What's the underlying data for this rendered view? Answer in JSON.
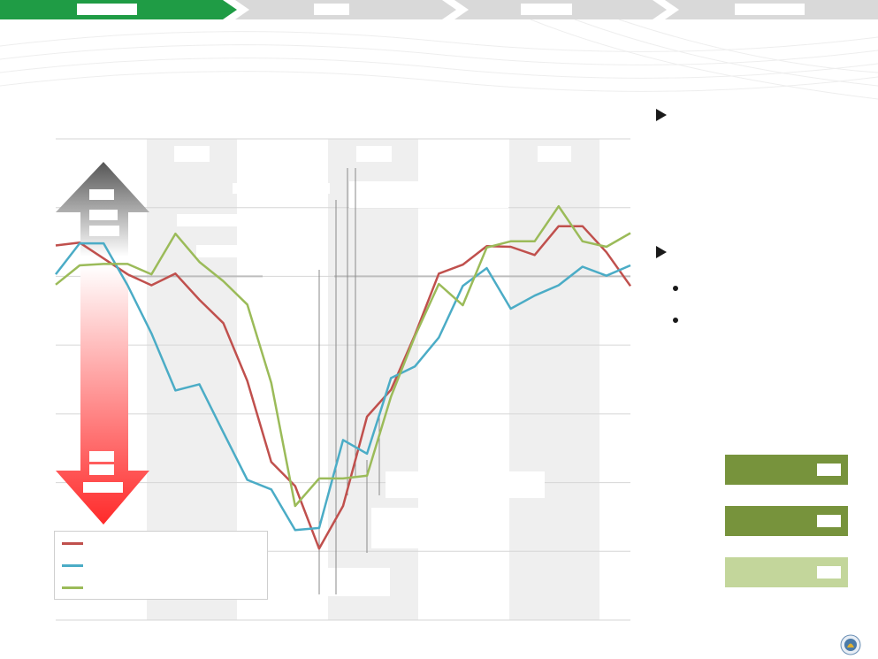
{
  "nav": {
    "steps": [
      {
        "label": "",
        "active": true
      },
      {
        "label": "",
        "active": false
      },
      {
        "label": "",
        "active": false
      },
      {
        "label": "",
        "active": false
      }
    ],
    "active_color": "#1f9c45",
    "inactive_color": "#d9d9d9"
  },
  "page": {
    "title": ""
  },
  "chart_data": {
    "type": "line",
    "title": "",
    "xlabel": "",
    "ylabel": "",
    "ylim": [
      0,
      7
    ],
    "grid": true,
    "legend_position": "bottom-left",
    "x": [
      0,
      1,
      2,
      3,
      4,
      5,
      6,
      7,
      8,
      9,
      10,
      11,
      12,
      13,
      14,
      15,
      16,
      17,
      18,
      19
    ],
    "series": [
      {
        "name": "",
        "color": "#c0504d",
        "values": [
          5.45,
          5.49,
          5.26,
          5.03,
          4.87,
          5.04,
          4.66,
          4.32,
          3.48,
          2.3,
          1.95,
          1.04,
          1.66,
          2.96,
          3.35,
          4.15,
          5.04,
          5.17,
          5.44,
          5.43,
          5.31,
          5.73,
          5.73,
          5.35,
          4.86
        ]
      },
      {
        "name": "",
        "color": "#4bacc6",
        "values": [
          5.03,
          5.48,
          5.48,
          4.87,
          4.17,
          3.34,
          3.43,
          2.73,
          2.04,
          1.9,
          1.31,
          1.34,
          2.62,
          2.42,
          3.52,
          3.69,
          4.11,
          4.86,
          5.12,
          4.53,
          4.72,
          4.87,
          5.14,
          5.01,
          5.16
        ]
      },
      {
        "name": "",
        "color": "#9bbb59",
        "values": [
          4.88,
          5.16,
          5.18,
          5.18,
          5.03,
          5.62,
          5.21,
          4.93,
          4.59,
          3.45,
          1.66,
          2.06,
          2.06,
          2.1,
          3.25,
          4.13,
          4.89,
          4.58,
          5.42,
          5.51,
          5.51,
          6.02,
          5.51,
          5.43,
          5.63
        ]
      }
    ],
    "band_color": "#efefef",
    "threshold": 5.0
  },
  "annotations": {
    "up_arrow_color": "#555555",
    "down_arrow_color": "#ff2a2a",
    "band_labels": [
      "",
      "",
      ""
    ],
    "callouts": [
      "",
      "",
      "",
      "",
      "",
      ""
    ]
  },
  "legend": {
    "items": [
      {
        "label": "",
        "color": "#c0504d"
      },
      {
        "label": "",
        "color": "#4bacc6"
      },
      {
        "label": "",
        "color": "#9bbb59"
      }
    ]
  },
  "right_panel": {
    "bullet1": "",
    "bullet2": "",
    "sub1": "",
    "sub2": "",
    "ratings": [
      {
        "tag": "",
        "color": "#77933c"
      },
      {
        "tag": "",
        "color": "#77933c"
      },
      {
        "tag": "",
        "color": "#c3d69b"
      }
    ]
  }
}
